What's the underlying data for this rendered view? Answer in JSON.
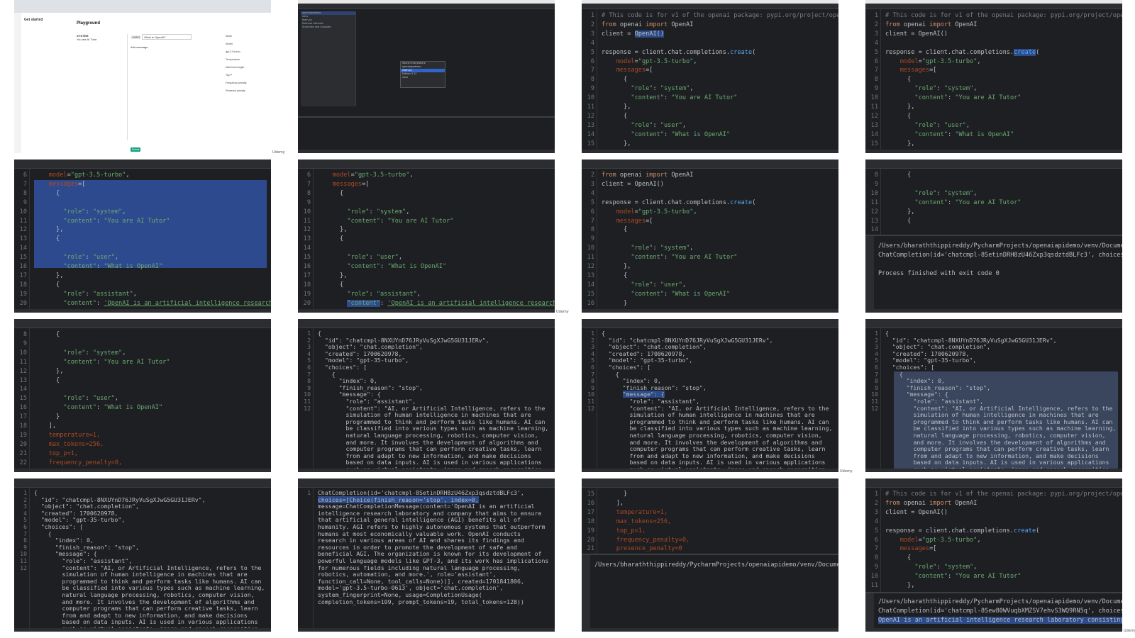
{
  "browser": {
    "get_started_title": "Get started",
    "playground_title": "Playground",
    "system_label": "SYSTEM",
    "system_value": "You are AI Tutor",
    "user_role": "USER",
    "user_value": "What is OpenAI?",
    "add_message": "Add message",
    "submit_label": "Submit",
    "mode_label": "Mode",
    "model_label": "Model",
    "model_value": "gpt-3.5-turbo",
    "temperature_label": "Temperature",
    "max_tokens_label": "Maximum length",
    "top_p_label": "Top P",
    "frequency_label": "Frequency penalty",
    "presence_label": "Presence penalty"
  },
  "popup": {
    "title": "Search Everywhere",
    "items": [
      "openaiapidemo",
      "main.py",
      "Python 3.12",
      "venv"
    ]
  },
  "project_tree": [
    "openaiapidemo",
    "venv",
    "main.py",
    "External Libraries",
    "Scratches and Consoles"
  ],
  "code": {
    "comment": "# This code is for v1 of the openai package: pypi.org/project/openai",
    "import_from": "from",
    "import_module": "openai",
    "import_kw": "import",
    "import_name": "OpenAI",
    "client_line": "client = ",
    "client_call": "OpenAI()",
    "response_line": "response = client.chat.completions.",
    "create": "create",
    "model_key": "model",
    "model_val": "\"gpt-3.5-turbo\"",
    "messages_key": "messages",
    "role_key": "\"role\"",
    "content_key": "\"content\"",
    "system_role": "\"system\"",
    "system_content": "\"You are AI Tutor\"",
    "user_role": "\"user\"",
    "user_content": "\"What is OpenAI\"",
    "assistant_role": "\"assistant\"",
    "assistant_content": "'OpenAI is an artificial intelligence research la",
    "temperature": "temperature=1,",
    "max_tokens": "max_tokens=256,",
    "top_p": "top_p=1,",
    "frequency_penalty": "frequency_penalty=0,",
    "presence_penalty": "presence_penalty=0"
  },
  "run_output": {
    "path": "/Users/bharaththippireddy/PycharmProjects/openaiapidemo/venv/Document",
    "line_a": "ChatCompletion(id='chatcmpl-8SetinDRH8zU46Zxp3qsdztdBLFc3', choices=[C",
    "exit": "Process finished with exit code 0",
    "line_b": "ChatCompletion(id='chatcmpl-8Sew80WVuqbXMZSV7ehvS3WQ9RN5q', choices=[C",
    "line_c": "OpenAI is an artificial intelligence research laboratory consisting o"
  },
  "json_response": {
    "id_line": "\"id\": \"chatcmpl-8NXUYnD76JRyVuSgXJwG5GU31JERv\",",
    "object_line": "\"object\": \"chat.completion\",",
    "created_line": "\"created\": 1700620978,",
    "model_line": "\"model\": \"gpt-35-turbo\",",
    "model_line_alt": "\"model\": \"gpt-35-turbo\",",
    "choices_line": "\"choices\": [",
    "index_line": "\"index\": 0,",
    "finish_line": "\"finish_reason\": \"stop\",",
    "message_line": "\"message\": {",
    "role_line": "\"role\": \"assistant\",",
    "content_lines": [
      "\"content\": \"AI, or Artificial Intelligence, refers to the",
      "simulation of human intelligence in machines that are",
      "programmed to think and perform tasks like humans. AI can",
      "be classified into various types such as machine learning,",
      "natural language processing, robotics, computer vision,",
      "and more. It involves the development of algorithms and",
      "computer programs that can perform creative tasks, learn",
      "from and adapt to new information, and make decisions",
      "based on data inputs. AI is used in various applications",
      "such as virtual assistants, image and speech recognition,"
    ]
  },
  "chat_completion_dump": [
    "ChatCompletion(id='chatcmpl-8SetinDRH8zU46Zxp3qsdztdBLFc3',",
    "choices=[Choice(finish_reason='stop', index=0,",
    "message=ChatCompletionMessage(content='OpenAI is an artificial",
    "intelligence research laboratory and company that aims to ensure",
    "that artificial general intelligence (AGI) benefits all of",
    "humanity. AGI refers to highly autonomous systems that outperform",
    "humans at most economically valuable work. OpenAI conducts",
    "research in various areas of AI and shares its findings and",
    "resources in order to promote the development of safe and",
    "beneficial AGI. The organization is known for its development of",
    "powerful language models like GPT-3, and its work has implications",
    "for numerous fields including natural language processing,",
    "robotics, automation, and more.', role='assistant',",
    "function_call=None, tool_calls=None))], created=1701841806,",
    "model='gpt-3.5-turbo-0613', object='chat.completion',",
    "system_fingerprint=None, usage=CompletionUsage(",
    "completion_tokens=109, prompt_tokens=19, total_tokens=128))"
  ],
  "caption": "Udemy"
}
